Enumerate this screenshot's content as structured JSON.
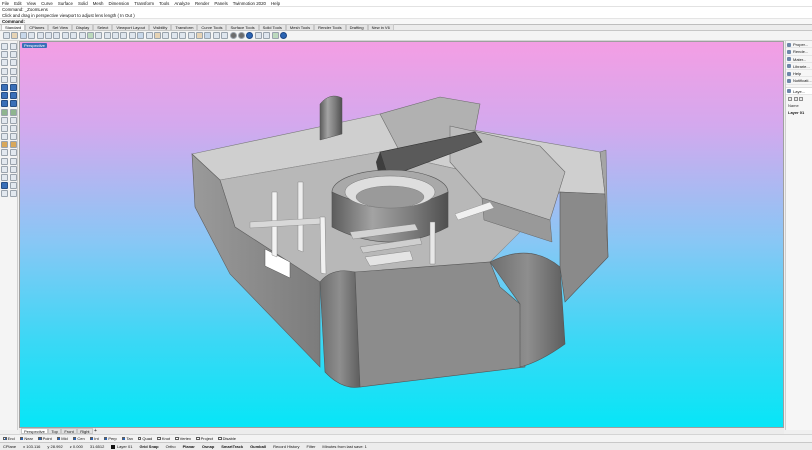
{
  "menu": [
    "File",
    "Edit",
    "View",
    "Curve",
    "Surface",
    "Solid",
    "Mesh",
    "Dimension",
    "Transform",
    "Tools",
    "Analyze",
    "Render",
    "Panels",
    "Twinmotion 2020",
    "Help"
  ],
  "command": {
    "history1": "Command: _ZoomLens",
    "history2": "Click and drag in perspective viewport to adjust lens length ( In  Out )",
    "prompt": "Command:"
  },
  "toolbar_tabs": [
    {
      "label": "Standard",
      "active": true
    },
    {
      "label": "CPlanes"
    },
    {
      "label": "Set View"
    },
    {
      "label": "Display"
    },
    {
      "label": "Select"
    },
    {
      "label": "Viewport Layout"
    },
    {
      "label": "Visibility"
    },
    {
      "label": "Transform"
    },
    {
      "label": "Curve Tools"
    },
    {
      "label": "Surface Tools"
    },
    {
      "label": "Solid Tools"
    },
    {
      "label": "Mesh Tools"
    },
    {
      "label": "Render Tools"
    },
    {
      "label": "Drafting"
    },
    {
      "label": "New in V6"
    }
  ],
  "viewport": {
    "label": "Perspective",
    "background_top": "#f49ee4",
    "background_bottom": "#06e6f7",
    "model_color": "#8a8a8a"
  },
  "right_panel": {
    "tabs": [
      "Proper...",
      "Rende...",
      "Mater...",
      "Librarie...",
      "Help",
      "Notificati..."
    ],
    "layers_tab": "Laye...",
    "column_header": "Name",
    "current_layer": "Layer 01"
  },
  "viewport_tabs": [
    {
      "label": "Perspective",
      "active": true
    },
    {
      "label": "Top"
    },
    {
      "label": "Front"
    },
    {
      "label": "Right"
    }
  ],
  "add_tab": "+",
  "osnaps": [
    {
      "label": "End",
      "checked": true
    },
    {
      "label": "Near",
      "checked": true
    },
    {
      "label": "Point",
      "checked": true
    },
    {
      "label": "Mid",
      "checked": true
    },
    {
      "label": "Cen",
      "checked": true
    },
    {
      "label": "Int",
      "checked": true
    },
    {
      "label": "Perp",
      "checked": true
    },
    {
      "label": "Tan",
      "checked": true
    },
    {
      "label": "Quad",
      "checked": false
    },
    {
      "label": "Knot",
      "checked": false
    },
    {
      "label": "Vertex",
      "checked": false
    },
    {
      "label": "Project",
      "checked": false
    },
    {
      "label": "Disable",
      "checked": false
    }
  ],
  "status": {
    "cplane": "CPlane",
    "x": "x 103.116",
    "y": "y 28.992",
    "z": "z 0.000",
    "units": "31.6512",
    "layer": "Layer 01",
    "toggles": [
      "Grid Snap",
      "Ortho",
      "Planar",
      "Osnap",
      "SmartTrack",
      "Gumball",
      "Record History",
      "Filter"
    ],
    "message": "Minutes from last save: 1"
  }
}
